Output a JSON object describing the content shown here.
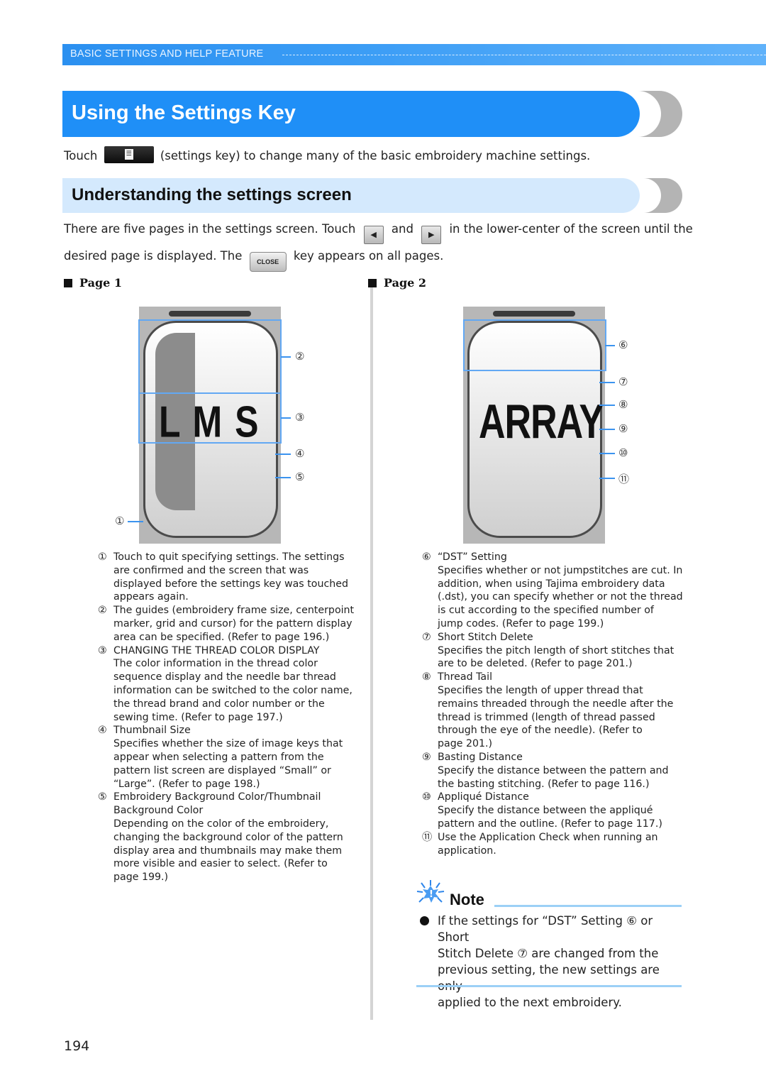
{
  "header": {
    "section_title": "BASIC SETTINGS AND HELP FEATURE"
  },
  "section": {
    "title": "Using the Settings Key",
    "intro_before": "Touch",
    "intro_after": "(settings key) to change many of the basic embroidery machine settings.",
    "settings_key_icon": "settings-list-icon"
  },
  "subsection": {
    "title": "Understanding the settings screen",
    "line1_before": "There are five pages in the settings screen. Touch",
    "line1_and": "and",
    "line1_after": "in the lower-center of the screen until the",
    "line2_before": "desired page is displayed. The",
    "line2_after": "key appears on all pages.",
    "prev_key_glyph": "◀",
    "next_key_glyph": "▶",
    "close_key_label": "CLOSE"
  },
  "page1": {
    "heading": "Page 1",
    "screen_text": "L M S",
    "callouts": [
      "①",
      "②",
      "③",
      "④",
      "⑤"
    ],
    "items": [
      {
        "num": "①",
        "title": "",
        "lines": [
          "Touch to quit specifying settings. The settings",
          "are confirmed and the screen that was",
          "displayed before the settings key was touched",
          "appears again."
        ]
      },
      {
        "num": "②",
        "title": "",
        "lines": [
          "The guides (embroidery frame size, centerpoint",
          "marker, grid and cursor) for the pattern display",
          "area can be specified. (Refer to page 196.)"
        ]
      },
      {
        "num": "③",
        "title": "CHANGING THE THREAD COLOR DISPLAY",
        "lines": [
          "The color information in the thread color",
          "sequence display and the needle bar thread",
          "information can be switched to the color name,",
          "the thread brand and color number or the",
          "sewing time. (Refer to page 197.)"
        ]
      },
      {
        "num": "④",
        "title": "Thumbnail Size",
        "lines": [
          "Specifies whether the size of image keys that",
          "appear when selecting a pattern from the",
          "pattern list screen are displayed “Small” or",
          "“Large”. (Refer to page 198.)"
        ]
      },
      {
        "num": "⑤",
        "title": "Embroidery Background Color/Thumbnail",
        "lines": [
          "Background Color",
          "Depending on the color of the embroidery,",
          "changing the background color of the pattern",
          "display area and thumbnails may make them",
          "more visible and easier to select. (Refer to",
          "page 199.)"
        ]
      }
    ]
  },
  "page2": {
    "heading": "Page 2",
    "screen_text": "ARRAY",
    "callouts": [
      "⑥",
      "⑦",
      "⑧",
      "⑨",
      "⑩",
      "⑪"
    ],
    "items": [
      {
        "num": "⑥",
        "title": "“DST” Setting",
        "lines": [
          "Specifies whether or not jumpstitches are cut. In",
          "addition, when using Tajima embroidery data",
          "(.dst), you can specify whether or not the thread",
          "is cut according to the specified number of",
          "jump codes. (Refer to page 199.)"
        ]
      },
      {
        "num": "⑦",
        "title": "Short Stitch Delete",
        "lines": [
          "Specifies the pitch length of short stitches that",
          "are to be deleted. (Refer to page 201.)"
        ]
      },
      {
        "num": "⑧",
        "title": "Thread Tail",
        "lines": [
          "Specifies the length of upper thread that",
          "remains threaded through the needle after the",
          "thread is trimmed (length of thread passed",
          "through the eye of the needle). (Refer to",
          "page 201.)"
        ]
      },
      {
        "num": "⑨",
        "title": "Basting Distance",
        "lines": [
          "Specify the distance between the pattern and",
          "the basting stitching. (Refer to page 116.)"
        ]
      },
      {
        "num": "⑩",
        "title": "Appliqué Distance",
        "lines": [
          "Specify the distance between the appliqué",
          "pattern and the outline. (Refer to page 117.)"
        ]
      },
      {
        "num": "⑪",
        "title": "",
        "lines": [
          "Use the Application Check when running an",
          "application."
        ]
      }
    ]
  },
  "note": {
    "title": "Note",
    "icon": "note-starburst-icon",
    "lines": [
      "If the settings for “DST” Setting ⑥ or Short",
      "Stitch Delete ⑦ are changed from the",
      "previous setting, the new settings are only",
      "applied to the next embroidery."
    ]
  },
  "footer": {
    "page_number": "194"
  },
  "colors": {
    "header_blue": "#2b90f0",
    "title_blue": "#1f8ff7",
    "subtitle_light_blue": "#d4e9fd",
    "callout_blue": "#3b93ef",
    "note_line": "#9cd0f6"
  }
}
